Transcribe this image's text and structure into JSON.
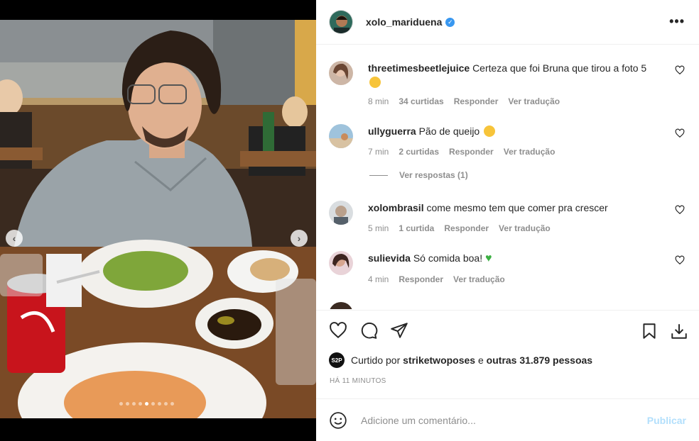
{
  "post": {
    "username": "xolo_mariduena",
    "verified_icon": "verified-badge-icon",
    "more_icon": "more-options-icon",
    "carousel": {
      "slide_count": 9,
      "active_slide": 5
    }
  },
  "comments": [
    {
      "username": "threetimesbeetlejuice",
      "text": "Certeza que foi Bruna que tirou a foto 5",
      "emoji": "grinning-face-emoji",
      "time": "8 min",
      "likes": "34 curtidas",
      "reply": "Responder",
      "translate": "Ver tradução"
    },
    {
      "username": "ullyguerra",
      "text": "Pão de queijo",
      "emoji": "heart-eyes-emoji",
      "time": "7 min",
      "likes": "2 curtidas",
      "reply": "Responder",
      "translate": "Ver tradução",
      "view_replies": "Ver respostas (1)"
    },
    {
      "username": "xolombrasil",
      "text": "come mesmo tem que comer pra crescer",
      "time": "5 min",
      "likes": "1 curtida",
      "reply": "Responder",
      "translate": "Ver tradução"
    },
    {
      "username": "sulievida",
      "text": "Só comida boa!",
      "emoji": "green-heart-emoji",
      "time": "4 min",
      "reply": "Responder",
      "translate": "Ver tradução"
    }
  ],
  "likes": {
    "prefix": "Curtido por",
    "user": "striketwoposes",
    "conjunction": "e",
    "others": "outras 31.879 pessoas",
    "avatar_text": "S2P"
  },
  "timestamp": "HÁ 11 MINUTOS",
  "add_comment": {
    "placeholder": "Adicione um comentário...",
    "publish_label": "Publicar"
  },
  "colors": {
    "verified": "#3897f0",
    "publish_disabled": "#b2dffc",
    "meta_text": "#8e8e8e",
    "green_heart": "#3cb043"
  }
}
